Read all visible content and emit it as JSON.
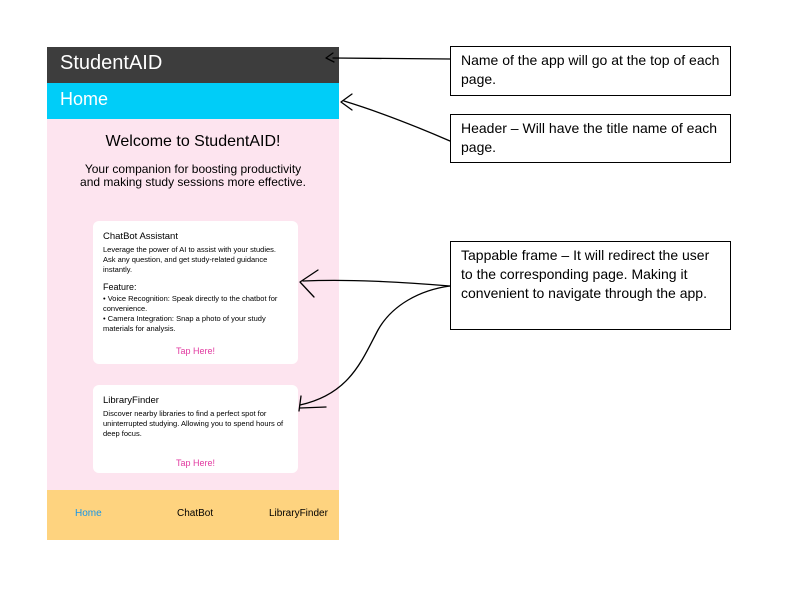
{
  "app": {
    "app_bar_title": "StudentAID",
    "header_title": "Home",
    "welcome_title": "Welcome to StudentAID!",
    "tagline": "Your companion for boosting productivity and making study sessions more effective.",
    "cards": [
      {
        "title": "ChatBot Assistant",
        "description": "Leverage the power of AI to assist with your studies. Ask any question, and get study-related guidance instantly.",
        "feature_heading": "Feature:",
        "features": [
          "• Voice Recognition: Speak directly to the chatbot for convenience.",
          "• Camera Integration: Snap a photo of your study materials for analysis."
        ],
        "action": "Tap Here!"
      },
      {
        "title": "LibraryFinder",
        "description": "Discover nearby libraries to find a perfect spot for uninterrupted studying. Allowing you to spend hours of deep focus.",
        "action": "Tap Here!"
      }
    ],
    "bottom_nav": [
      "Home",
      "ChatBot",
      "LibraryFinder"
    ]
  },
  "annotations": [
    "Name of the app will go at the top of each page.",
    "Header – Will have the title name of each page.",
    "Tappable frame – It will redirect the user to the corresponding page. Making it convenient to navigate through the app."
  ],
  "colors": {
    "app_bar": "#3d3d3d",
    "header": "#00cdf8",
    "page_background": "#fde4ef",
    "card": "#ffffff",
    "tap_link": "#e13aa0",
    "bottom_nav": "#fed37f",
    "nav_active": "#1796e6"
  }
}
